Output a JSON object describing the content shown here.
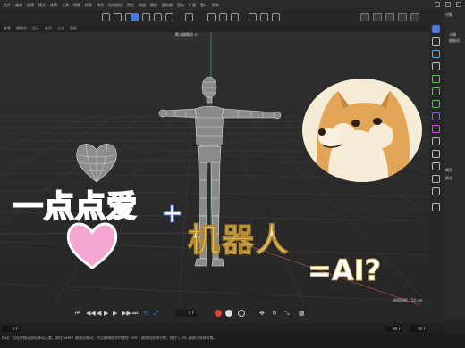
{
  "menubar": {
    "items": [
      "文件",
      "编辑",
      "创建",
      "模式",
      "选择",
      "工具",
      "网格",
      "样条",
      "体积",
      "运动图形",
      "角色",
      "动画",
      "模拟",
      "跟踪器",
      "渲染",
      "扩展",
      "窗口",
      "帮助"
    ]
  },
  "view_menu": {
    "items": [
      "查看",
      "摄像机",
      "显示",
      "选项",
      "过滤",
      "面板"
    ]
  },
  "viewport": {
    "camera_label": "默认摄像机 ⊙",
    "grid_distance": "网格间距 : 50 cm",
    "overlay": {
      "line1": "一点点爱",
      "plus": "+",
      "line2": "机器人",
      "line3": "=AI?"
    }
  },
  "right_panel": {
    "objects_tab": "对象",
    "objects_items": [
      "人偶",
      "摄像机"
    ],
    "attributes_tab": "属性",
    "mode_label": "模式"
  },
  "timeline": {
    "frame_value": "0 F",
    "start_frame": "0 F",
    "end_frame": "90 F",
    "end_frame2": "90 F"
  },
  "status": {
    "text": "移动：点击并拖动鼠标移动元素。按住 SHIFT 键量化移动；节点编辑模式时按住 SHIFT 键增加选择对象；按住 CTRL 键减少选择对象。"
  },
  "colors": {
    "accent_blue": "#4a7ad9",
    "record_red": "#d9463e",
    "pink_text": "#f6a8a0",
    "yellow_text": "#fff5cf"
  }
}
